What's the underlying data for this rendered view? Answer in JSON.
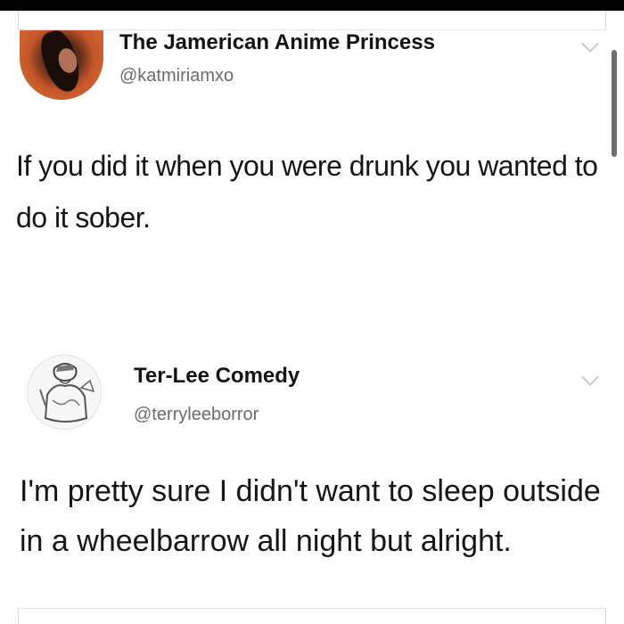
{
  "tweets": [
    {
      "display_name": "The Jamerican Anime Princess",
      "handle": "@katmiriamxo",
      "text": "If you did it when you were drunk you wanted to do it sober."
    },
    {
      "display_name": "Ter-Lee Comedy",
      "handle": "@terryleeborror",
      "text": "I'm pretty sure I didn't want to sleep outside in a wheelbarrow all night but alright."
    }
  ],
  "icons": {
    "menu": "chevron-down-icon",
    "avatar": "avatar"
  },
  "colors": {
    "background": "#ffffff",
    "text": "#161616",
    "handle": "#6b6b6b",
    "chevron": "#c9c9c9"
  }
}
